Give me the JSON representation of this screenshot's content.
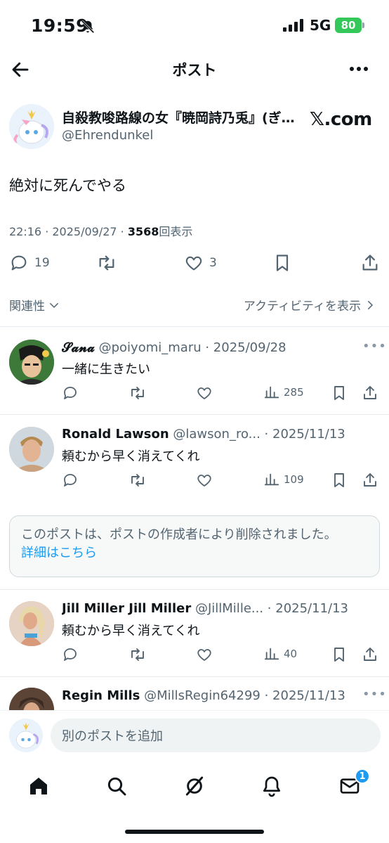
{
  "status_bar": {
    "time": "19:59",
    "network": "5G",
    "battery": "80"
  },
  "header": {
    "title": "ポスト"
  },
  "post": {
    "author_name": "自殺教唆路線の女『暁岡詩乃兎』(ぎ…",
    "author_handle": "@Ehrendunkel",
    "source": "𝕏.com",
    "text": "絶対に死んでやる",
    "timestamp": "22:16 · 2025/09/27 · ",
    "views_count": "3568",
    "views_label": "回表示",
    "reply_count": "19",
    "like_count": "3"
  },
  "filter": {
    "sort_label": "関連性",
    "activity_label": "アクティビティを表示"
  },
  "replies": [
    {
      "name": "𝓢𝓪𝓷𝓪",
      "handle": "@poiyomi_maru",
      "date": "· 2025/09/28",
      "text": "一緒に生きたい",
      "views": "285"
    },
    {
      "name": "Ronald Lawson",
      "handle": "@lawson_ro...",
      "date": "· 2025/11/13",
      "text": "頼むから早く消えてくれ",
      "views": "109"
    },
    {
      "name": "Jill Miller Jill Miller",
      "handle": "@JillMille...",
      "date": "· 2025/11/13",
      "text": "頼むから早く消えてくれ",
      "views": "40"
    },
    {
      "name": "Regin Mills",
      "handle": "@MillsRegin64299",
      "date": "· 2025/11/13",
      "text": "",
      "views": ""
    }
  ],
  "deleted_notice": {
    "text": "このポストは、ポストの作成者により削除されました。",
    "link": "詳細はこちら"
  },
  "compose": {
    "placeholder": "別のポストを追加"
  },
  "tabbar": {
    "notification_badge": "1"
  },
  "colors": {
    "accent": "#1d9bf0",
    "text": "#0f1419",
    "muted": "#536471",
    "battery": "#34c759"
  }
}
